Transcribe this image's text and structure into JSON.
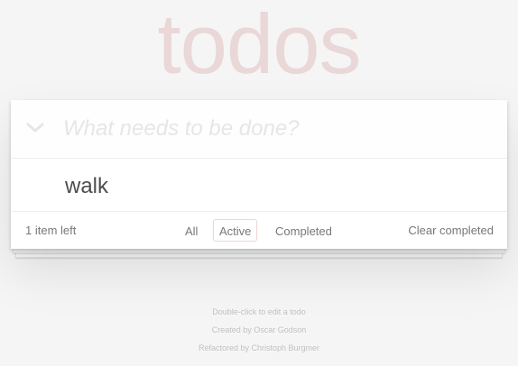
{
  "app": {
    "title": "todos"
  },
  "new_todo": {
    "placeholder": "What needs to be done?",
    "value": ""
  },
  "toggle_all": {
    "icon": "chevron-down-icon"
  },
  "todos": [
    {
      "label": "walk",
      "completed": false
    }
  ],
  "footer": {
    "count_text": "1 item left",
    "filters": [
      {
        "label": "All",
        "selected": false
      },
      {
        "label": "Active",
        "selected": true
      },
      {
        "label": "Completed",
        "selected": false
      }
    ],
    "clear_completed": "Clear completed"
  },
  "info": {
    "hint": "Double-click to edit a todo",
    "created_by": "Created by Oscar Godson",
    "refactored_by": "Refactored by Christoph Burgmer"
  },
  "colors": {
    "background": "#f5f5f5",
    "title": "rgba(175, 47, 47, 0.15)",
    "selected_filter_border": "rgba(175, 47, 47, 0.2)",
    "text": "#4d4d4d"
  }
}
